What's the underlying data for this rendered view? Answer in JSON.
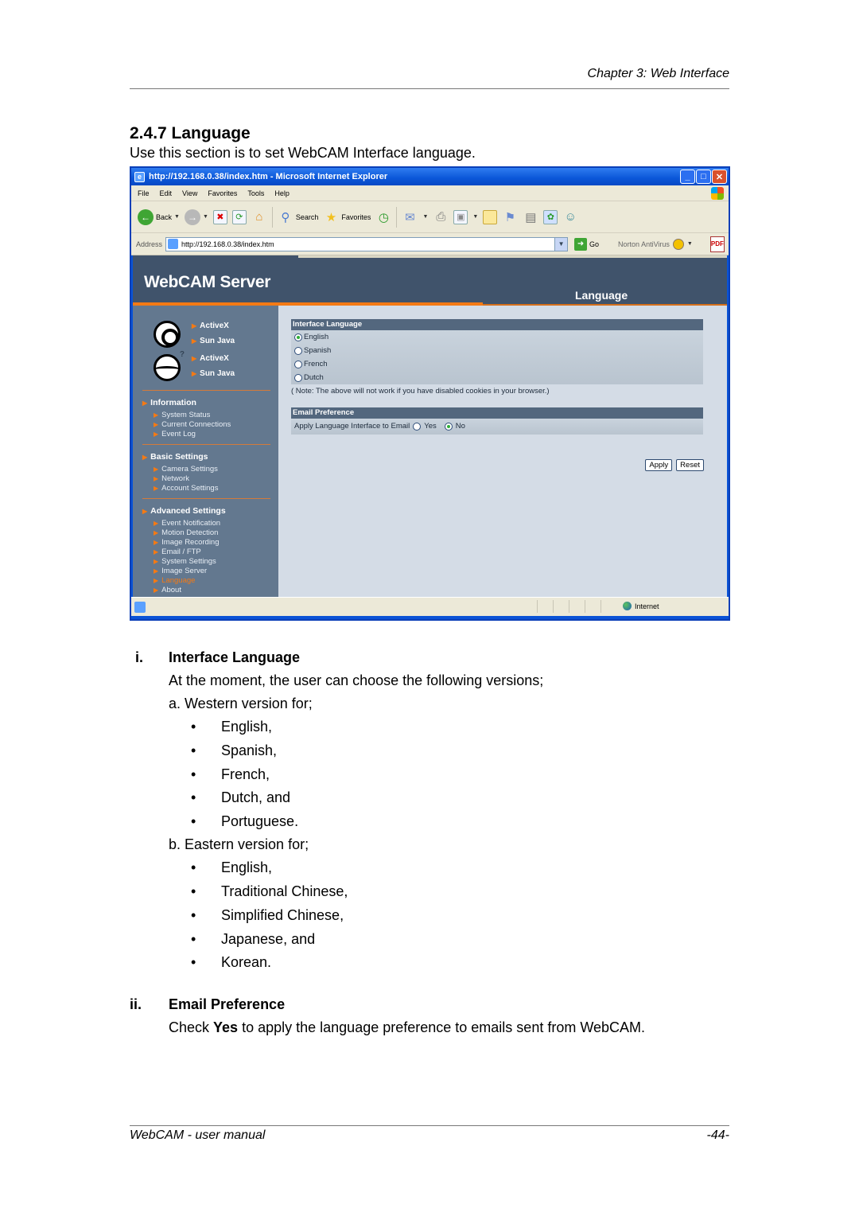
{
  "page": {
    "running_header": "Chapter 3: Web Interface",
    "section_title": "2.4.7 Language",
    "intro": "Use this section is to set WebCAM Interface language.",
    "footer_left": "WebCAM - user manual",
    "footer_right": "-44-"
  },
  "browser": {
    "title": "http://192.168.0.38/index.htm - Microsoft Internet Explorer",
    "window_buttons": [
      "minimize",
      "maximize",
      "close"
    ],
    "menu": [
      "File",
      "Edit",
      "View",
      "Favorites",
      "Tools",
      "Help"
    ],
    "toolbar": {
      "back_label": "Back",
      "search_label": "Search",
      "favorites_label": "Favorites"
    },
    "address": {
      "label": "Address",
      "value": "http://192.168.0.38/index.htm",
      "go_label": "Go",
      "norton_label": "Norton AntiVirus"
    },
    "status": {
      "zone": "Internet"
    }
  },
  "webcam": {
    "brand": "WebCAM Server",
    "page_label": "Language",
    "camera_links": [
      {
        "label": "ActiveX"
      },
      {
        "label": "Sun Java"
      },
      {
        "label": "ActiveX"
      },
      {
        "label": "Sun Java"
      }
    ],
    "nav_groups": [
      {
        "title": "Information",
        "items": [
          "System Status",
          "Current Connections",
          "Event Log"
        ]
      },
      {
        "title": "Basic Settings",
        "items": [
          "Camera Settings",
          "Network",
          "Account Settings"
        ]
      },
      {
        "title": "Advanced Settings",
        "items": [
          "Event Notification",
          "Motion Detection",
          "Image Recording",
          "Email / FTP",
          "System Settings",
          "Image Server",
          "Language",
          "About"
        ],
        "active": "Language"
      }
    ],
    "interface_language": {
      "heading": "Interface Language",
      "options": [
        "English",
        "Spanish",
        "French",
        "Dutch"
      ],
      "selected": "English",
      "note": "( Note: The above will not work if you have disabled cookies in your browser.)"
    },
    "email_preference": {
      "heading": "Email Preference",
      "label": "Apply Language Interface to Email",
      "options": [
        "Yes",
        "No"
      ],
      "selected": "No"
    },
    "buttons": {
      "apply": "Apply",
      "reset": "Reset"
    }
  },
  "body": {
    "sub1": {
      "num": "i.",
      "title": "Interface Language",
      "lead": "At the moment, the user can choose the following versions;",
      "western_label": "a. Western version for;",
      "western": [
        "English,",
        "Spanish,",
        "French,",
        "Dutch, and",
        "Portuguese."
      ],
      "eastern_label": "b. Eastern version for;",
      "eastern": [
        "English,",
        "Traditional Chinese,",
        "Simplified Chinese,",
        "Japanese, and",
        "Korean."
      ]
    },
    "sub2": {
      "num": "ii.",
      "title": "Email Preference",
      "text_before": "Check ",
      "text_bold": "Yes",
      "text_after": " to apply the language preference to emails sent from WebCAM."
    },
    "bullet_glyph": "•"
  }
}
